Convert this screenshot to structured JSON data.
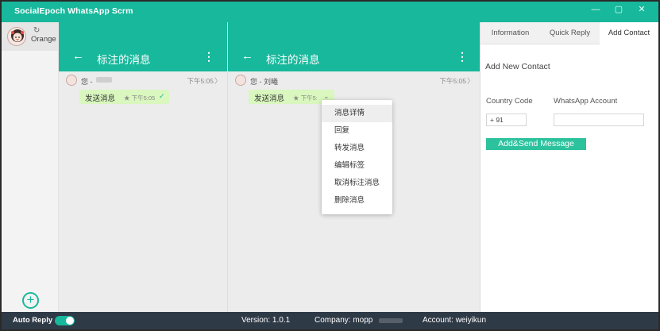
{
  "app": {
    "title": "SocialEpoch WhatsApp Scrm"
  },
  "window": {
    "minimize": "—",
    "restore": "▢",
    "close": "✕"
  },
  "colors": {
    "accent": "#18b89c",
    "bubble": "#d9f7be",
    "footer": "#2f3a47",
    "button": "#2cc29e"
  },
  "account": {
    "refresh_icon": "↻",
    "name": "Orange"
  },
  "left_rail": {
    "add_icon": "+"
  },
  "panels": [
    {
      "back_icon": "←",
      "title": "标注的消息",
      "more_icon": "⋮",
      "sender": "您 - ",
      "time": "下午5:05",
      "chevron": "〉",
      "message": "发送消息",
      "meta": "★ 下午5:05",
      "check": "✓"
    },
    {
      "back_icon": "←",
      "title": "标注的消息",
      "more_icon": "⋮",
      "sender": "您 - 刘曦",
      "time": "下午5:05",
      "chevron": "〉",
      "message": "发送消息",
      "meta": "★ 下午5:",
      "dropdown": "⌄"
    }
  ],
  "context_menu": {
    "items": [
      "消息详情",
      "回复",
      "转发消息",
      "编辑标签",
      "取消标注消息",
      "删除消息"
    ]
  },
  "info_panel": {
    "tabs": [
      "Information",
      "Quick Reply",
      "Add Contact"
    ],
    "heading": "Add New Contact",
    "country_code_label": "Country Code",
    "whatsapp_label": "WhatsApp Account",
    "country_code_value": "+ 91",
    "whatsapp_value": "",
    "send_button": "Add&Send Message"
  },
  "footer": {
    "auto_reply": "Auto Reply",
    "version": "Version:  1.0.1",
    "company": "Company:  mopp",
    "account": "Account:  weiyikun"
  }
}
